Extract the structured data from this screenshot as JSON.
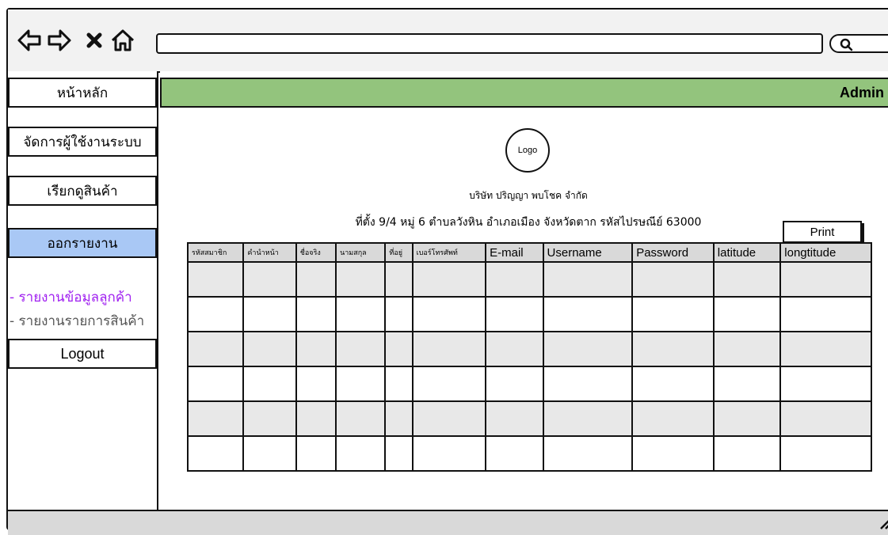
{
  "sidebar": {
    "items": [
      {
        "label": "หน้าหลัก"
      },
      {
        "label": "จัดการผู้ใช้งานระบบ"
      },
      {
        "label": "เรียกดูสินค้า"
      },
      {
        "label": "ออกรายงาน"
      }
    ],
    "subitems": [
      {
        "label": "- รายงานข้อมูลลูกค้า"
      },
      {
        "label": "- รายงานรายการสินค้า"
      }
    ],
    "logout_label": "Logout"
  },
  "header": {
    "user_label": "Admin"
  },
  "report": {
    "logo_label": "Logo",
    "company_name": "บริษัท ปริญญา พบโชค จำกัด",
    "address": "ที่ตั้ง 9/4 หมู่ 6 ตำบลวังหิน อำเภอเมือง จังหวัดตาก รหัสไปรษณีย์ 63000",
    "print_label": "Print",
    "columns": [
      "รหัสสมาชิก",
      "คำนำหน้า",
      "ชื่อจริง",
      "นามสกุล",
      "ที่อยู่",
      "เบอร์โทรศัพท์",
      "E-mail",
      "Username",
      "Password",
      "latitude",
      "longtitude"
    ]
  },
  "colors": {
    "header_green": "#93c47d",
    "active_menu_blue": "#a9c8f5",
    "current_subitem_purple": "#a020f0"
  }
}
